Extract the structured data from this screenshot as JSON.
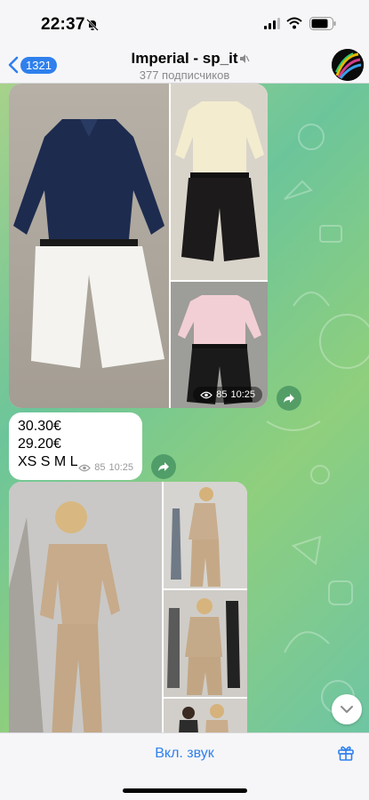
{
  "status": {
    "time": "22:37"
  },
  "header": {
    "back_badge": "1321",
    "title": "Imperial - sp_it",
    "subtitle": "377 подписчиков"
  },
  "messages": [
    {
      "type": "album",
      "views": "85",
      "time": "10:25"
    },
    {
      "type": "text",
      "lines": [
        "30.30€",
        "29.20€",
        "XS S M L"
      ],
      "views": "85",
      "time": "10:25"
    },
    {
      "type": "album"
    }
  ],
  "bottom": {
    "sound_button": "Вкл. звук"
  },
  "colors": {
    "accent": "#2f80ed",
    "chat_bg": "#8fcf7d"
  },
  "icons": [
    "back-chevron-icon",
    "mute-icon",
    "eye-icon",
    "forward-icon",
    "chevron-down-icon",
    "gift-icon"
  ]
}
